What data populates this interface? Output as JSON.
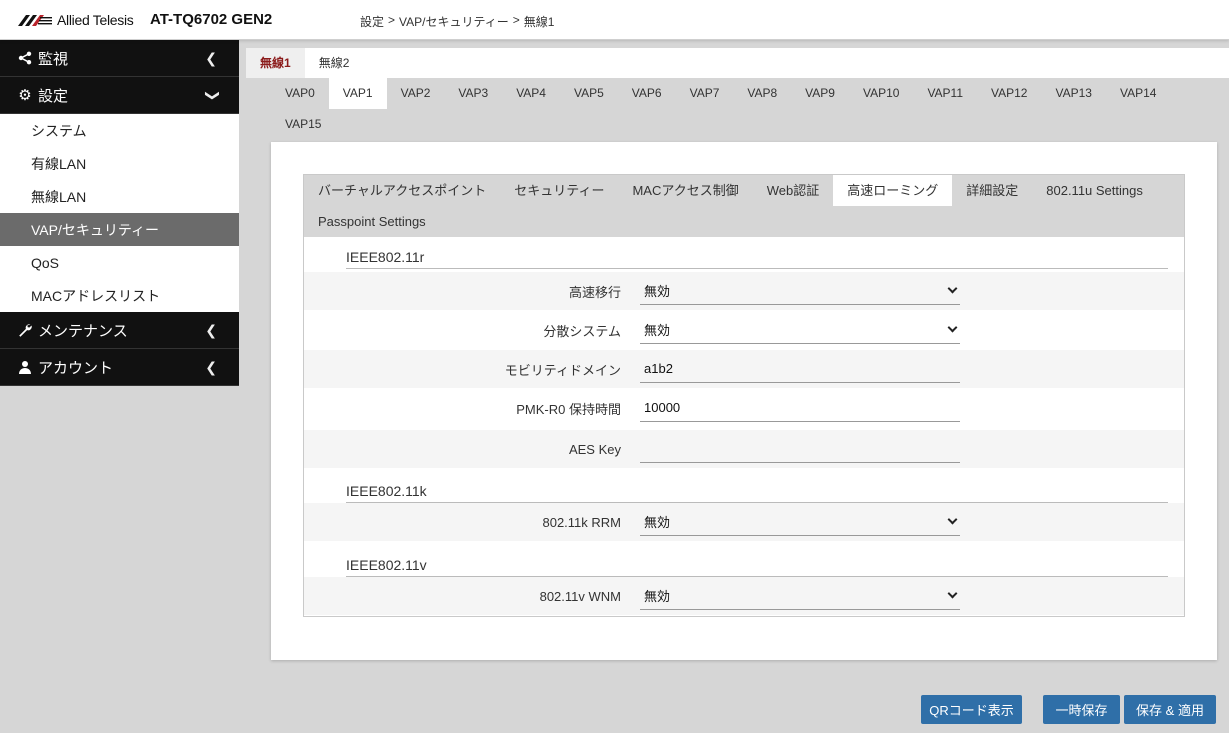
{
  "header": {
    "logo_text": "Allied Telesis",
    "product": "AT-TQ6702 GEN2",
    "breadcrumb": [
      "設定",
      ">",
      "VAP/セキュリティー",
      ">",
      "無線1"
    ]
  },
  "sidebar": {
    "monitor": "監視",
    "settings": "設定",
    "settings_items": [
      "システム",
      "有線LAN",
      "無線LAN",
      "VAP/セキュリティー",
      "QoS",
      "MACアドレスリスト"
    ],
    "active_item": "VAP/セキュリティー",
    "maintenance": "メンテナンス",
    "account": "アカウント"
  },
  "radio_tabs": [
    "無線1",
    "無線2"
  ],
  "vap_tabs": [
    "VAP0",
    "VAP1",
    "VAP2",
    "VAP3",
    "VAP4",
    "VAP5",
    "VAP6",
    "VAP7",
    "VAP8",
    "VAP9",
    "VAP10",
    "VAP11",
    "VAP12",
    "VAP13",
    "VAP14",
    "VAP15"
  ],
  "sub_tabs": [
    "バーチャルアクセスポイント",
    "セキュリティー",
    "MACアクセス制御",
    "Web認証",
    "高速ローミング",
    "詳細設定",
    "802.11u Settings",
    "Passpoint Settings"
  ],
  "sections": {
    "r": {
      "title": "IEEE802.11r",
      "fast_transition": {
        "label": "高速移行",
        "value": "無効"
      },
      "distributed_system": {
        "label": "分散システム",
        "value": "無効"
      },
      "mobility_domain": {
        "label": "モビリティドメイン",
        "value": "a1b2"
      },
      "pmk_r0": {
        "label": "PMK-R0 保持時間",
        "value": "10000"
      },
      "aes_key": {
        "label": "AES Key",
        "value": ""
      }
    },
    "k": {
      "title": "IEEE802.11k",
      "rrm": {
        "label": "802.11k RRM",
        "value": "無効"
      }
    },
    "v": {
      "title": "IEEE802.11v",
      "wnm": {
        "label": "802.11v WNM",
        "value": "無効"
      }
    }
  },
  "buttons": {
    "qr": "QRコード表示",
    "temp_save": "一時保存",
    "save_apply": "保存 & 適用"
  },
  "colors": {
    "sidebar_head": "#111111",
    "active_item": "#6b6b6b",
    "button": "#2f6fa8",
    "active_radio_tab": "#8b1a1a"
  }
}
